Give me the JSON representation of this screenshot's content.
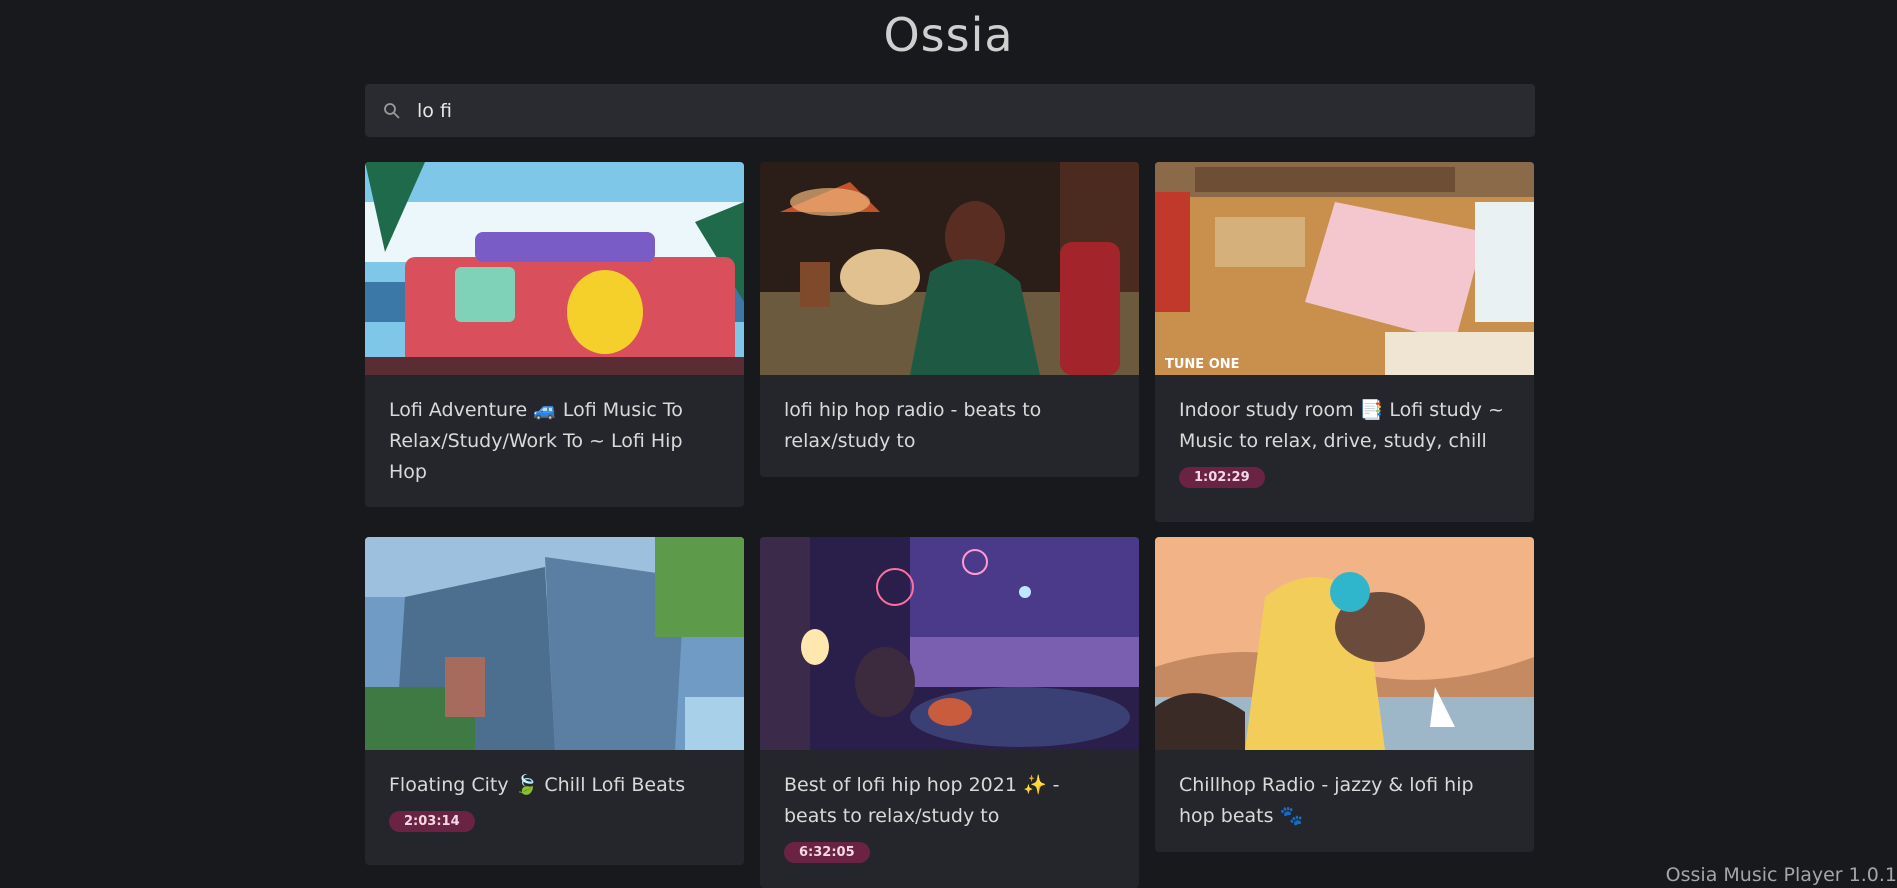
{
  "app": {
    "name": "Ossia",
    "footer": "Ossia Music Player 1.0.1"
  },
  "search": {
    "value": "lo fi",
    "icon": "search-icon"
  },
  "results": [
    {
      "title": "Lofi Adventure 🚙 Lofi Music To Relax/Study/Work To ~ Lofi Hip Hop",
      "duration": ""
    },
    {
      "title": "lofi hip hop radio - beats to relax/study to",
      "duration": ""
    },
    {
      "title": "Indoor study room 📑 Lofi study ~ Music to relax, drive, study, chill",
      "duration": "1:02:29",
      "thumb_text": "TUNE ONE"
    },
    {
      "title": "Floating City 🍃 Chill Lofi Beats",
      "duration": "2:03:14"
    },
    {
      "title": "Best of lofi hip hop 2021 ✨ - beats to relax/study to",
      "duration": "6:32:05"
    },
    {
      "title": "Chillhop Radio - jazzy & lofi hip hop beats 🐾",
      "duration": ""
    }
  ]
}
